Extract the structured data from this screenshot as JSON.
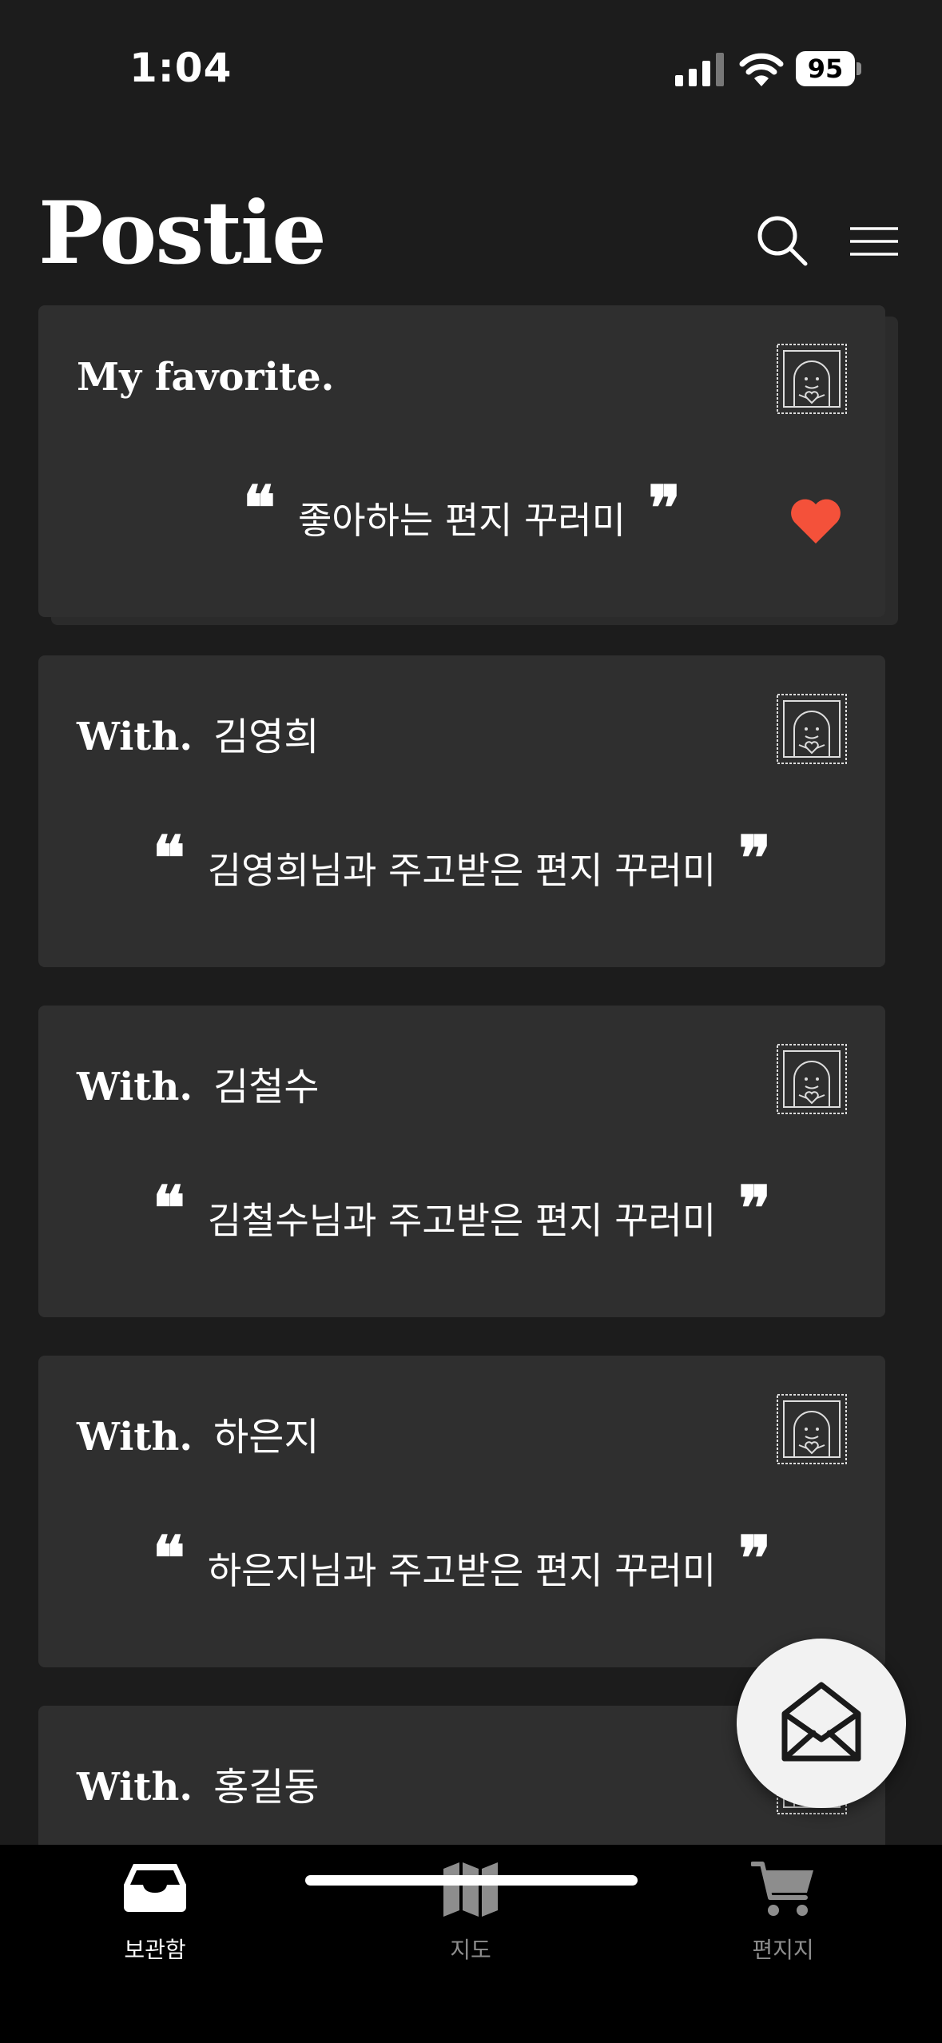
{
  "status_bar": {
    "time": "1:04",
    "battery": "95"
  },
  "header": {
    "title": "Postie"
  },
  "favorite": {
    "heading": "My favorite.",
    "description": "좋아하는 편지 꾸러미",
    "favorited": true
  },
  "conversations": [
    {
      "prefix": "With.",
      "name": "김영희",
      "description": "김영희님과 주고받은 편지 꾸러미"
    },
    {
      "prefix": "With.",
      "name": "김철수",
      "description": "김철수님과 주고받은 편지 꾸러미"
    },
    {
      "prefix": "With.",
      "name": "하은지",
      "description": "하은지님과 주고받은 편지 꾸러미"
    },
    {
      "prefix": "With.",
      "name": "홍길동",
      "description": ""
    }
  ],
  "quote": {
    "open": "❝",
    "close": "❞"
  },
  "bottom_nav": [
    {
      "label": "보관함",
      "icon": "inbox-tray-icon",
      "active": true
    },
    {
      "label": "지도",
      "icon": "map-icon",
      "active": false
    },
    {
      "label": "편지지",
      "icon": "cart-icon",
      "active": false
    }
  ],
  "colors": {
    "background": "#1c1c1c",
    "card": "#2f2f2f",
    "heart": "#f4513a",
    "fab": "#f2f2f2",
    "nav": "#000000"
  },
  "fab": {
    "icon": "open-envelope-icon"
  }
}
